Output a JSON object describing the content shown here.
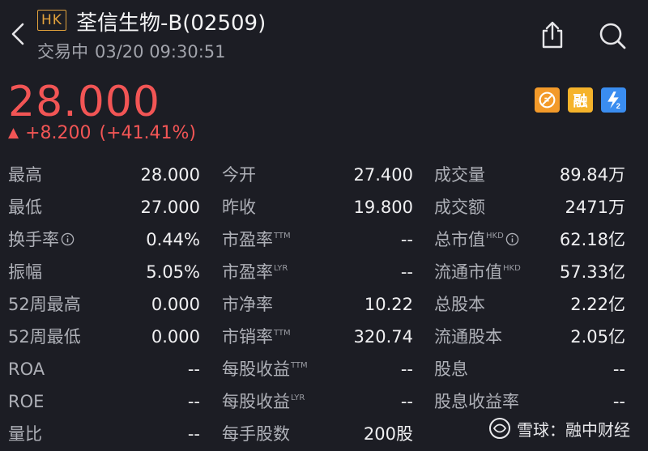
{
  "header": {
    "market_badge": "HK",
    "title": "荃信生物-B(02509)",
    "status": "交易中",
    "datetime": "03/20 09:30:51"
  },
  "quote": {
    "price": "28.000",
    "change": "+8.200",
    "change_pct": "(+41.41%)",
    "color_up": "#f25555"
  },
  "stats": [
    [
      {
        "label": "最高",
        "value": "28.000"
      },
      {
        "label": "今开",
        "value": "27.400"
      },
      {
        "label": "成交量",
        "value": "89.84万"
      }
    ],
    [
      {
        "label": "最低",
        "value": "27.000"
      },
      {
        "label": "昨收",
        "value": "19.800"
      },
      {
        "label": "成交额",
        "value": "2471万"
      }
    ],
    [
      {
        "label": "换手率",
        "value": "0.44%"
      },
      {
        "label": "市盈率",
        "sup": "TTM",
        "value": "--"
      },
      {
        "label": "总市值",
        "sup": "HKD",
        "value": "62.18亿"
      }
    ],
    [
      {
        "label": "振幅",
        "value": "5.05%"
      },
      {
        "label": "市盈率",
        "sup": "LYR",
        "value": "--"
      },
      {
        "label": "流通市值",
        "sup": "HKD",
        "value": "57.33亿"
      }
    ],
    [
      {
        "label": "52周最高",
        "value": "0.000"
      },
      {
        "label": "市净率",
        "value": "10.22"
      },
      {
        "label": "总股本",
        "value": "2.22亿"
      }
    ],
    [
      {
        "label": "52周最低",
        "value": "0.000"
      },
      {
        "label": "市销率",
        "sup": "TTM",
        "value": "320.74"
      },
      {
        "label": "流通股本",
        "value": "2.05亿"
      }
    ],
    [
      {
        "label": "ROA",
        "value": "--"
      },
      {
        "label": "每股收益",
        "sup": "TTM",
        "value": "--"
      },
      {
        "label": "股息",
        "value": "--"
      }
    ],
    [
      {
        "label": "ROE",
        "value": "--"
      },
      {
        "label": "每股收益",
        "sup": "LYR",
        "value": "--"
      },
      {
        "label": "股息收益率",
        "value": "--"
      }
    ],
    [
      {
        "label": "量比",
        "value": "--"
      },
      {
        "label": "每手股数",
        "value": "200股"
      },
      {
        "label": "",
        "value": ""
      }
    ]
  ],
  "badges": {
    "yellow_text": "融"
  },
  "watermark": {
    "text": "雪球：融中财经"
  },
  "icons": [
    "back-icon",
    "share-icon",
    "search-icon",
    "info-icon",
    "snowball-logo-icon"
  ]
}
